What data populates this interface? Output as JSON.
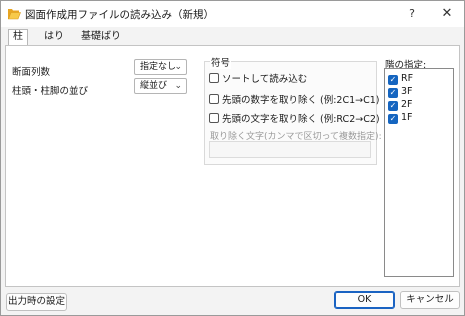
{
  "window": {
    "title": "図面作成用ファイルの読み込み（新規）",
    "help_label": "?",
    "close_label": "✕"
  },
  "tabs": [
    {
      "label": "柱",
      "active": true
    },
    {
      "label": "はり",
      "active": false
    },
    {
      "label": "基礎ばり",
      "active": false
    }
  ],
  "left": {
    "section_count_label": "断面列数",
    "section_count_value": "指定なし",
    "order_label": "柱頭・柱脚の並び",
    "order_value": "縦並び"
  },
  "symbol": {
    "title": "符号",
    "options": [
      {
        "label": "ソートして読み込む",
        "checked": false
      },
      {
        "label": "先頭の数字を取り除く (例:2C1→C1)",
        "checked": false
      },
      {
        "label": "先頭の文字を取り除く (例:RC2→C2)",
        "checked": false
      }
    ],
    "remove_chars_label": "取り除く文字(カンマで区切って複数指定):",
    "remove_chars_value": ""
  },
  "layers": {
    "title": "階の指定:",
    "items": [
      {
        "label": "RF",
        "checked": true
      },
      {
        "label": "3F",
        "checked": true
      },
      {
        "label": "2F",
        "checked": true
      },
      {
        "label": "1F",
        "checked": true
      }
    ]
  },
  "footer": {
    "output_settings_label": "出力時の設定",
    "ok_label": "OK",
    "cancel_label": "キャンセル"
  },
  "colors": {
    "accent": "#1565c0",
    "app_icon": "#f2b233"
  }
}
